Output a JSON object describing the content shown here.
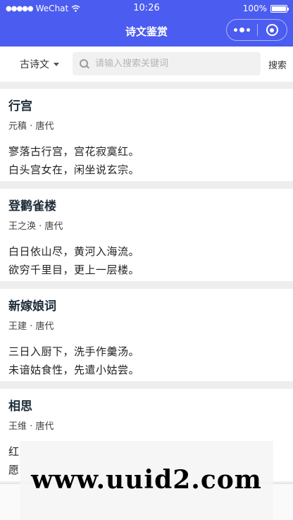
{
  "status_bar": {
    "signal": "●●●●●",
    "carrier": "WeChat",
    "wifi_icon": "wifi-icon",
    "time": "10:26",
    "battery": "100%",
    "battery_level": 1.0
  },
  "nav": {
    "title": "诗文鉴赏",
    "more_icon": "more-dots-icon",
    "close_icon": "target-close-icon"
  },
  "search": {
    "dynasty_label": "古诗文",
    "placeholder": "请输入搜索关键词",
    "value": "",
    "button": "搜索"
  },
  "poems": [
    {
      "title": "行宫",
      "meta": "元稹 · 唐代",
      "line1": "寥落古行宫，宫花寂寞红。",
      "line2": "白头宫女在，闲坐说玄宗。"
    },
    {
      "title": "登鹳雀楼",
      "meta": "王之涣 · 唐代",
      "line1": "白日依山尽，黄河入海流。",
      "line2": "欲穷千里目，更上一层楼。"
    },
    {
      "title": "新嫁娘词",
      "meta": "王建 · 唐代",
      "line1": "三日入厨下，洗手作羹汤。",
      "line2": "未谙姑食性，先遣小姑尝。"
    },
    {
      "title": "相思",
      "meta": "王维 · 唐代",
      "line1": "红",
      "line2": "愿"
    }
  ],
  "tabs": [
    {
      "label": "",
      "active": false
    },
    {
      "label": "",
      "active": false
    },
    {
      "label": "",
      "active": false
    },
    {
      "label": "",
      "active": true
    }
  ],
  "watermark": "www.uuid2.com",
  "colors": {
    "accent": "#4b5cf0",
    "background": "#eeeeee"
  }
}
